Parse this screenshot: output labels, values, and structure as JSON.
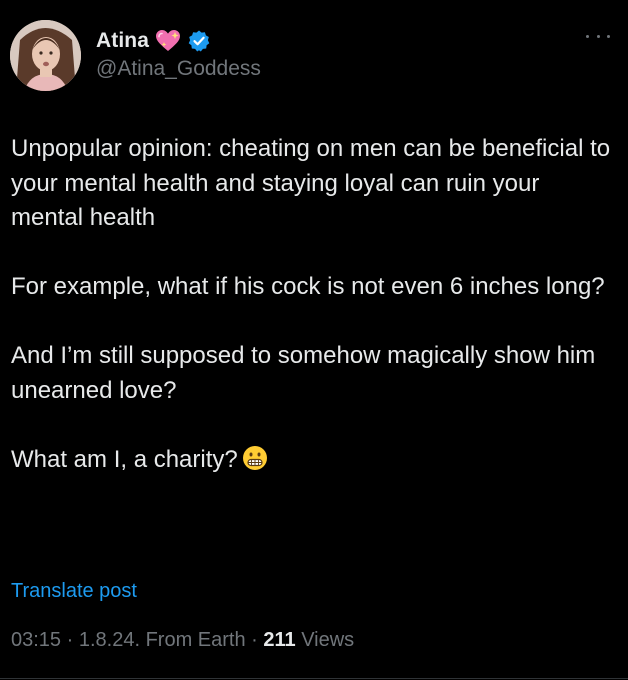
{
  "user": {
    "name": "Atina",
    "handle": "@Atina_Goddess",
    "badges": [
      "sparkling-heart-emoji",
      "verified-badge-icon"
    ],
    "verified_color": "#1d9bf0"
  },
  "tweet": {
    "paragraphs": [
      "Unpopular opinion: cheating on men can be beneficial to your mental health and staying loyal can ruin your mental health",
      "For example, what if his cock is not even 6 inches long?",
      "And I’m still supposed to somehow magically show him unearned love?",
      "What am I, a charity?"
    ],
    "trailing_emoji": "grimacing-face-emoji"
  },
  "translate_label": "Translate post",
  "meta": {
    "time": "03:15",
    "sep1": " · ",
    "date": "1.8.24.",
    "source": " From Earth",
    "sep2": " · ",
    "views_count": "211",
    "views_label": " Views"
  },
  "colors": {
    "background": "#000000",
    "text": "#e7e9ea",
    "secondary": "#71767b",
    "link": "#1d9bf0"
  }
}
